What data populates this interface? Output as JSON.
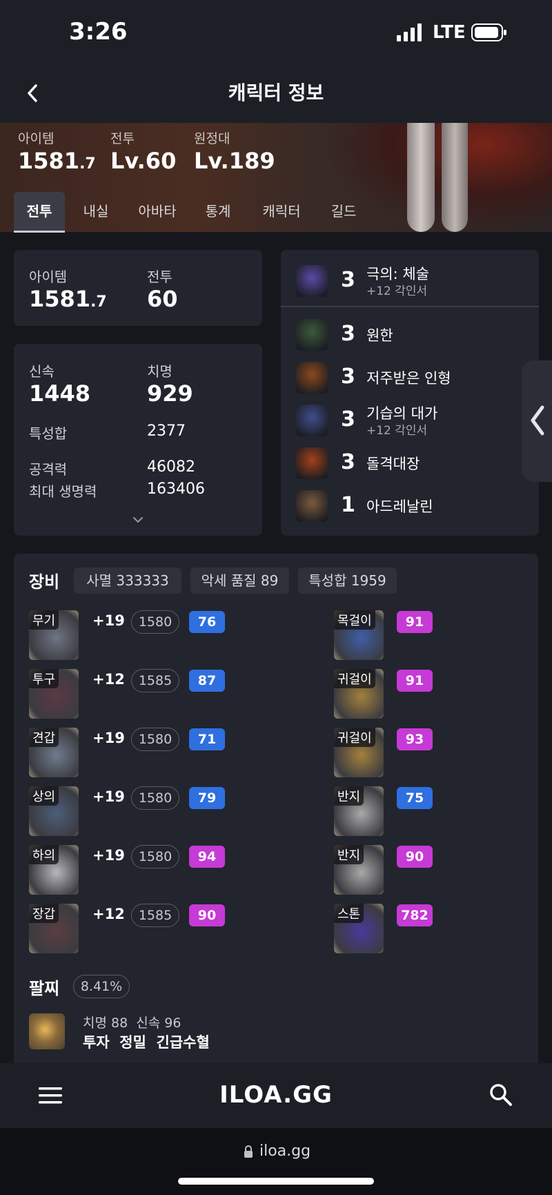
{
  "status_bar": {
    "time": "3:26",
    "network": "LTE"
  },
  "header": {
    "title": "캐릭터 정보"
  },
  "hero": {
    "item_label": "아이템",
    "item_value_main": "1581",
    "item_value_decimal": ".7",
    "combat_label": "전투",
    "combat_value": "Lv.60",
    "roster_label": "원정대",
    "roster_value": "Lv.189"
  },
  "tabs": [
    "전투",
    "내실",
    "아바타",
    "통계",
    "캐릭터",
    "길드"
  ],
  "summary": {
    "item_label": "아이템",
    "item_value_main": "1581",
    "item_value_decimal": ".7",
    "combat_label": "전투",
    "combat_value": "60"
  },
  "stats": {
    "swift_label": "신속",
    "swift_value": "1448",
    "crit_label": "치명",
    "crit_value": "929",
    "total_label": "특성합",
    "total_value": "2377",
    "atk_label": "공격력",
    "atk_value": "46082",
    "hp_label": "최대 생명력",
    "hp_value": "163406"
  },
  "engravings": [
    {
      "level": "3",
      "name": "극의: 체술",
      "sub": "+12 각인서",
      "icon": "martial-arts-icon",
      "color": "#5b4aa8"
    },
    {
      "level": "3",
      "name": "원한",
      "sub": "",
      "icon": "grudge-icon",
      "color": "#3c5a3a"
    },
    {
      "level": "3",
      "name": "저주받은 인형",
      "sub": "",
      "icon": "cursed-doll-icon",
      "color": "#8a4a1c"
    },
    {
      "level": "3",
      "name": "기습의 대가",
      "sub": "+12 각인서",
      "icon": "master-ambush-icon",
      "color": "#3f4f8c"
    },
    {
      "level": "3",
      "name": "돌격대장",
      "sub": "",
      "icon": "raid-captain-icon",
      "color": "#a2401c"
    },
    {
      "level": "1",
      "name": "아드레날린",
      "sub": "",
      "icon": "adrenaline-icon",
      "color": "#7a5a3c"
    }
  ],
  "equipment": {
    "title": "장비",
    "chips": [
      "사멸 333333",
      "악세 품질 89",
      "특성합 1959"
    ],
    "gear": [
      {
        "slot": "무기",
        "plus": "+19",
        "level": "1580",
        "quality": "76",
        "qcolor": "blue",
        "icon": "weapon-icon"
      },
      {
        "slot": "투구",
        "plus": "+12",
        "level": "1585",
        "quality": "87",
        "qcolor": "blue",
        "icon": "helmet-icon"
      },
      {
        "slot": "견갑",
        "plus": "+19",
        "level": "1580",
        "quality": "71",
        "qcolor": "blue",
        "icon": "shoulder-icon"
      },
      {
        "slot": "상의",
        "plus": "+19",
        "level": "1580",
        "quality": "79",
        "qcolor": "blue",
        "icon": "chest-icon"
      },
      {
        "slot": "하의",
        "plus": "+19",
        "level": "1580",
        "quality": "94",
        "qcolor": "pink",
        "icon": "pants-icon"
      },
      {
        "slot": "장갑",
        "plus": "+12",
        "level": "1585",
        "quality": "90",
        "qcolor": "pink",
        "icon": "gloves-icon"
      }
    ],
    "accessories": [
      {
        "slot": "목걸이",
        "quality": "91",
        "qcolor": "pink",
        "icon": "necklace-icon"
      },
      {
        "slot": "귀걸이",
        "quality": "91",
        "qcolor": "pink",
        "icon": "earring-icon"
      },
      {
        "slot": "귀걸이",
        "quality": "93",
        "qcolor": "pink",
        "icon": "earring-icon"
      },
      {
        "slot": "반지",
        "quality": "75",
        "qcolor": "blue",
        "icon": "ring-icon"
      },
      {
        "slot": "반지",
        "quality": "90",
        "qcolor": "pink",
        "icon": "ring-icon"
      },
      {
        "slot": "스톤",
        "quality": "782",
        "qcolor": "pink",
        "icon": "ability-stone-icon"
      }
    ]
  },
  "bracelet": {
    "title": "팔찌",
    "percent": "8.41%",
    "stats_line": "치명 88  신속 96",
    "effects_line": "투자  정밀  긴급수혈"
  },
  "bottom_nav": {
    "logo": "ILOA.GG"
  },
  "url_bar": {
    "url": "iloa.gg"
  },
  "colors": {
    "blue_quality": "#2f6fe0",
    "pink_quality": "#c63ad5",
    "background": "#15171c",
    "card": "#22252d"
  }
}
